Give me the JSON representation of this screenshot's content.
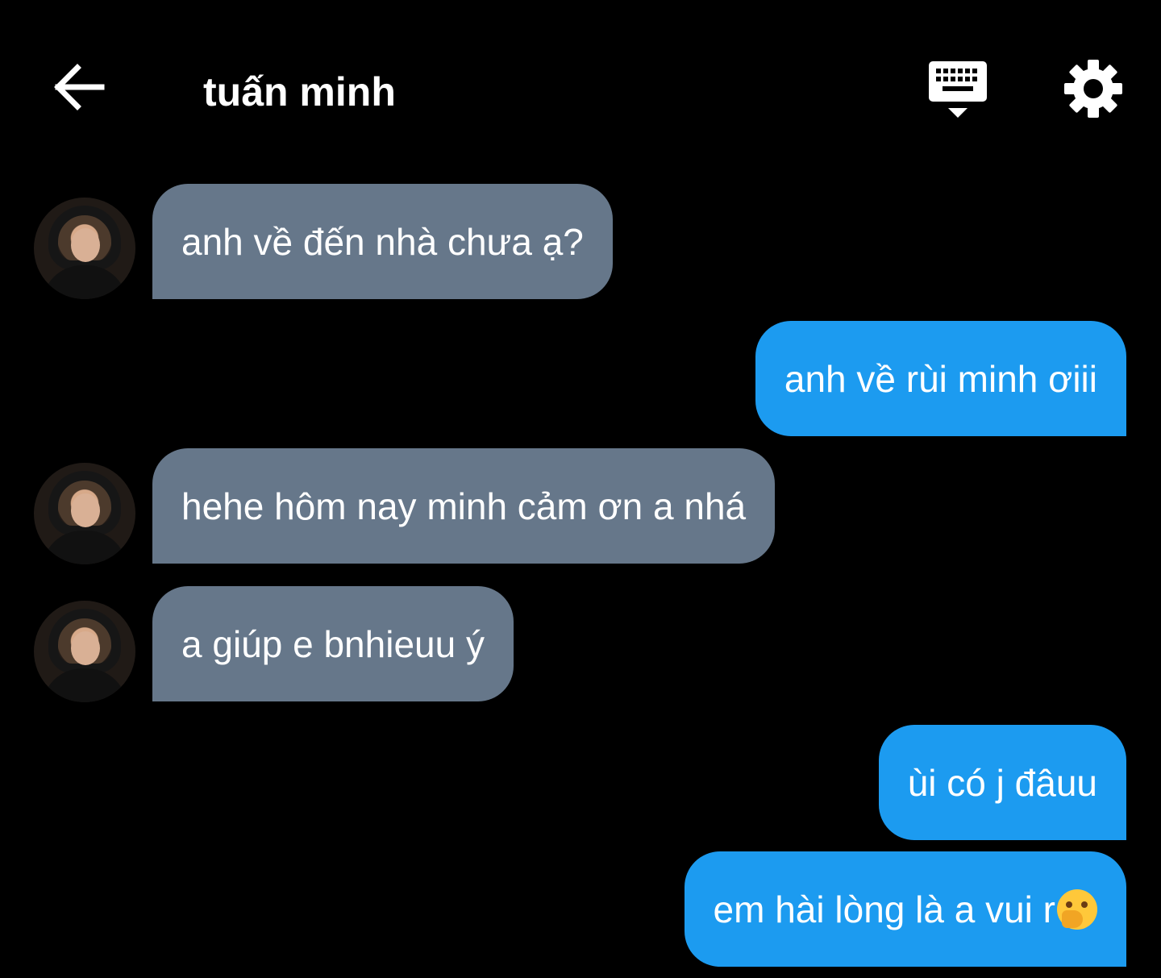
{
  "header": {
    "contact_name": "tuấn minh",
    "back_icon": "arrow-left-icon",
    "keyboard_icon": "keyboard-icon",
    "settings_icon": "gear-icon"
  },
  "colors": {
    "background": "#000000",
    "incoming_bubble": "#66778a",
    "outgoing_bubble": "#1c9bf0",
    "text": "#ffffff"
  },
  "messages": [
    {
      "sender": "contact",
      "text": "anh về đến nhà chưa ạ?"
    },
    {
      "sender": "me",
      "text": "anh về rùi minh ơiii"
    },
    {
      "sender": "contact",
      "text": "hehe hôm nay minh cảm ơn a nhá"
    },
    {
      "sender": "contact",
      "text": "a giúp e bnhieuu ý"
    },
    {
      "sender": "me",
      "text": "ùi có j đâuu"
    },
    {
      "sender": "me",
      "text": "em hài lòng là a vui r",
      "emoji": "face-with-hand-over-mouth"
    }
  ]
}
